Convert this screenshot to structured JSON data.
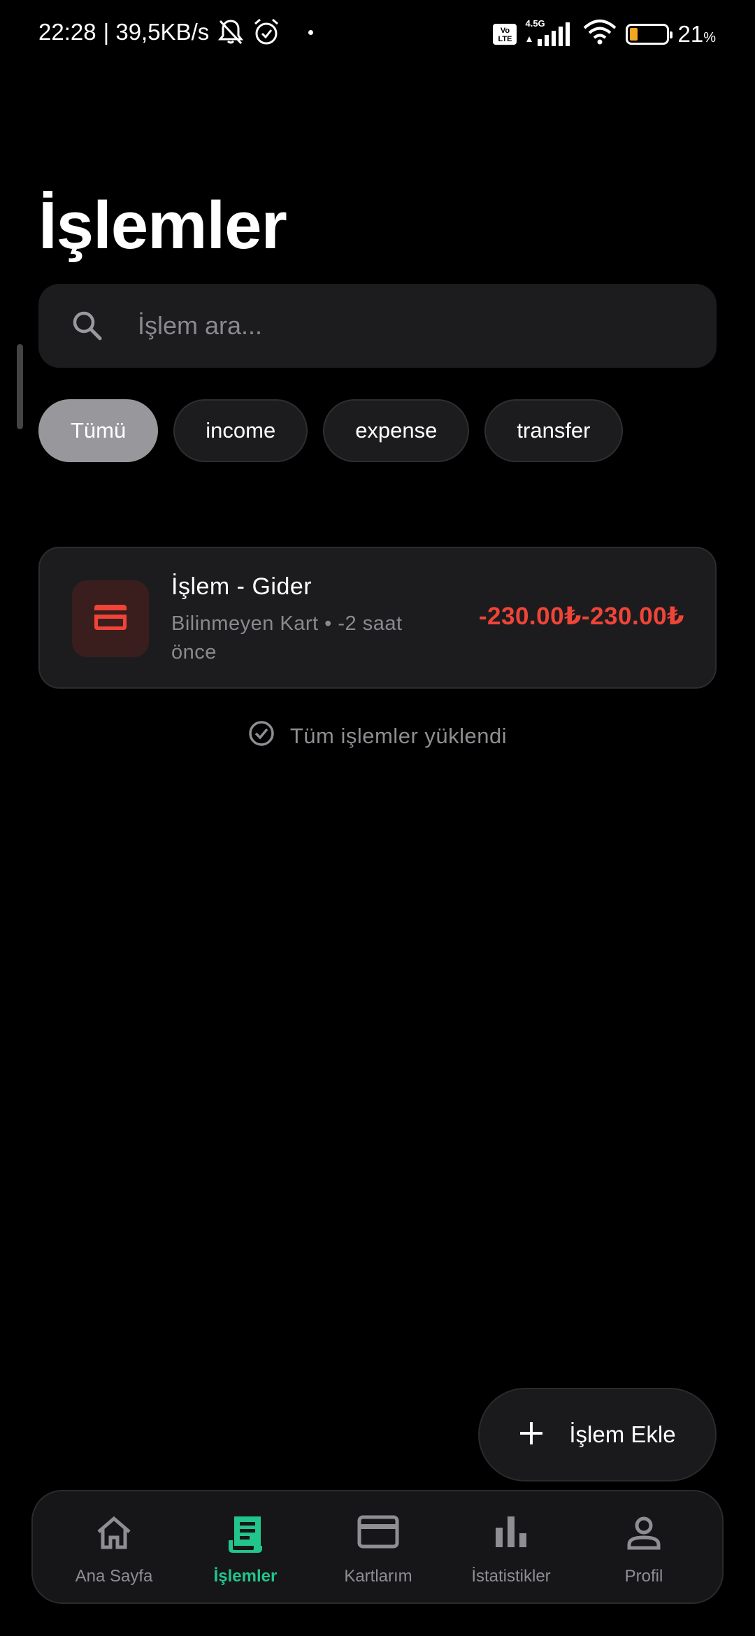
{
  "status_bar": {
    "time": "22:28",
    "speed": "| 39,5KB/s",
    "network_gen": "4.5G",
    "volte": "Vo LTE",
    "battery_percent": "21",
    "battery_unit": "%",
    "battery_level": 0.21
  },
  "page": {
    "title": "İşlemler"
  },
  "search": {
    "placeholder": "İşlem ara..."
  },
  "filters": [
    {
      "label": "Tümü",
      "active": true
    },
    {
      "label": "income",
      "active": false
    },
    {
      "label": "expense",
      "active": false
    },
    {
      "label": "transfer",
      "active": false
    }
  ],
  "transactions": [
    {
      "title": "İşlem - Gider",
      "subtitle": "Bilinmeyen Kart • -2 saat önce",
      "amount": "-230.00₺-230.00₺",
      "icon": "credit-card-icon"
    }
  ],
  "list_status": "Tüm işlemler yüklendi",
  "fab": {
    "label": "İşlem Ekle"
  },
  "nav": [
    {
      "label": "Ana Sayfa",
      "icon": "home-icon",
      "active": false
    },
    {
      "label": "İşlemler",
      "icon": "receipt-icon",
      "active": true
    },
    {
      "label": "Kartlarım",
      "icon": "credit-card-icon",
      "active": false
    },
    {
      "label": "İstatistikler",
      "icon": "bar-chart-icon",
      "active": false
    },
    {
      "label": "Profil",
      "icon": "person-icon",
      "active": false
    }
  ],
  "colors": {
    "accent": "#22c58b",
    "expense": "#f04438",
    "background": "#000000",
    "surface": "#1c1c1e"
  }
}
